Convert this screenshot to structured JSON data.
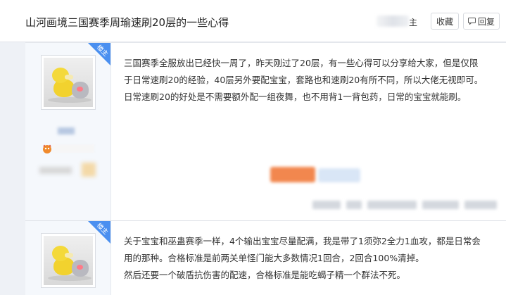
{
  "header": {
    "title": "山河画境三国赛季周瑜速刷20层的一些心得",
    "only_lz_label": "主",
    "favorite_label": "收藏",
    "reply_label": "回复"
  },
  "posts": [
    {
      "badge": "楼主",
      "avatar": "avatar-image",
      "content_lines": [
        "三国赛季全服放出已经快一周了，昨天刚过了20层，有一些心得可以分享给大家，但是仅限",
        "于日常速刷20的经验，40层另外要配宝宝，套路也和速刷20有所不同，所以大佬无视即可。",
        "日常速刷20的好处是不需要额外配一组夜舞，也不用背1一背包药，日常的宝宝就能刷。"
      ]
    },
    {
      "badge": "楼主",
      "avatar": "avatar-image",
      "content_lines": [
        "关于宝宝和巫蛊赛季一样，4个输出宝宝尽量配满，我是带了1须弥2全力1血攻，都是日常会",
        "用的那种。合格标准是前两关单怪门能大多数情况1回合，2回合100%清掉。",
        "然后还要一个破盾抗伤害的配速，合格标准是能吃蝎子精一个群法不死。"
      ]
    }
  ],
  "colors": {
    "badge_blue": "#4a8ff0",
    "accent_orange": "#f2874e"
  }
}
